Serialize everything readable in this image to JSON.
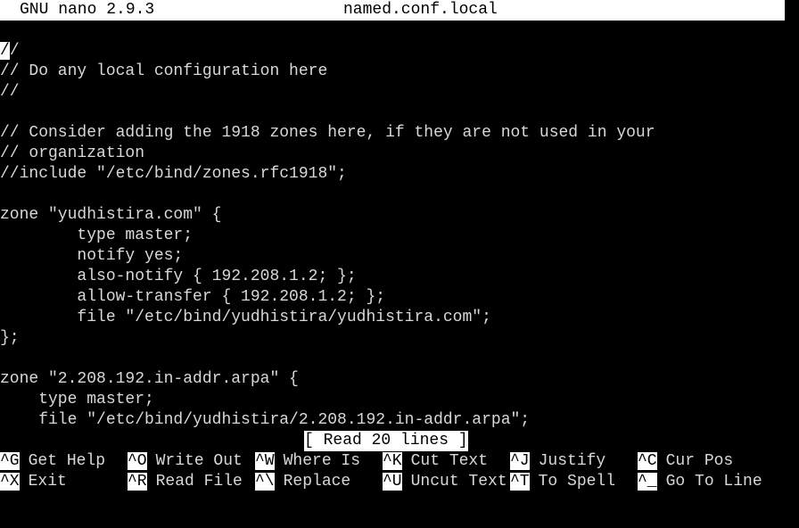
{
  "titlebar": {
    "app": "GNU nano 2.9.3",
    "file": "named.conf.local"
  },
  "editor": {
    "cursor_char": "/",
    "lines": [
      "/",
      "// Do any local configuration here",
      "//",
      "",
      "// Consider adding the 1918 zones here, if they are not used in your",
      "// organization",
      "//include \"/etc/bind/zones.rfc1918\";",
      "",
      "zone \"yudhistira.com\" {",
      "        type master;",
      "        notify yes;",
      "        also-notify { 192.208.1.2; };",
      "        allow-transfer { 192.208.1.2; };",
      "        file \"/etc/bind/yudhistira/yudhistira.com\";",
      "};",
      "",
      "zone \"2.208.192.in-addr.arpa\" {",
      "    type master;",
      "    file \"/etc/bind/yudhistira/2.208.192.in-addr.arpa\";"
    ]
  },
  "status": "[ Read 20 lines ]",
  "shortcuts": [
    {
      "key": "^G",
      "label": "Get Help"
    },
    {
      "key": "^O",
      "label": "Write Out"
    },
    {
      "key": "^W",
      "label": "Where Is"
    },
    {
      "key": "^K",
      "label": "Cut Text"
    },
    {
      "key": "^J",
      "label": "Justify"
    },
    {
      "key": "^C",
      "label": "Cur Pos"
    },
    {
      "key": "^X",
      "label": "Exit"
    },
    {
      "key": "^R",
      "label": "Read File"
    },
    {
      "key": "^\\",
      "label": "Replace"
    },
    {
      "key": "^U",
      "label": "Uncut Text"
    },
    {
      "key": "^T",
      "label": "To Spell"
    },
    {
      "key": "^_",
      "label": "Go To Line"
    }
  ],
  "colors": {
    "background": "#000000",
    "foreground": "#d8d8d8",
    "inverse_bg": "#ffffff",
    "inverse_fg": "#000000"
  }
}
